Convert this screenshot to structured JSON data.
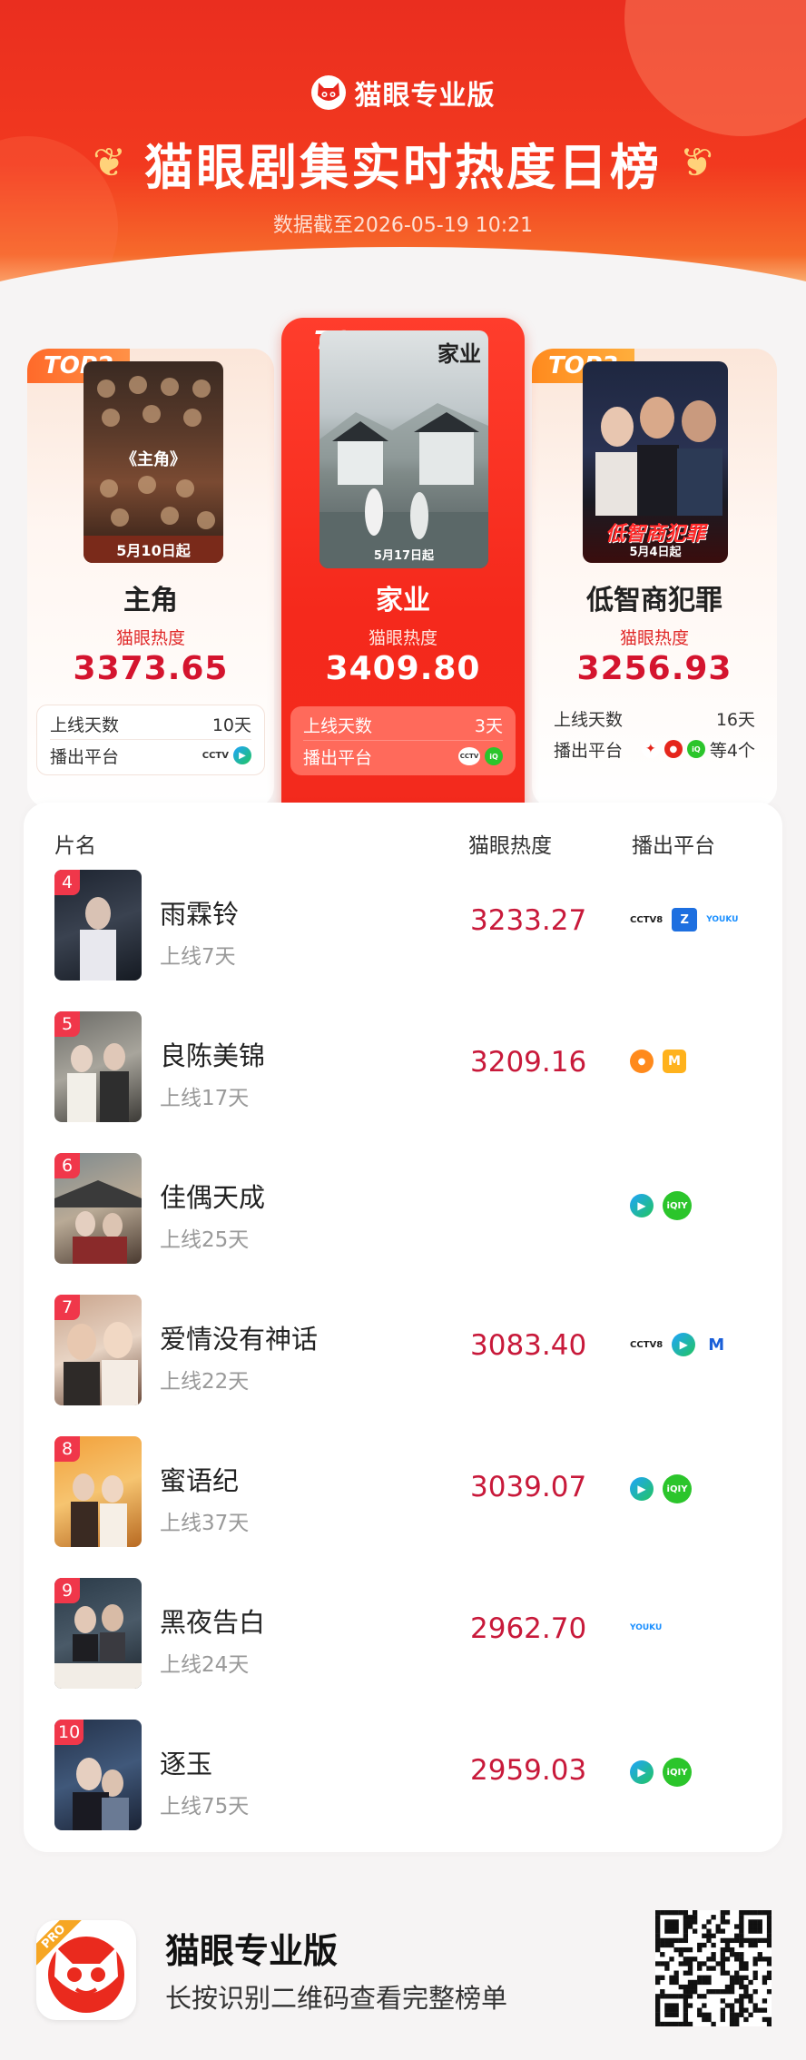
{
  "header": {
    "brand": "猫眼专业版",
    "title": "猫眼剧集实时热度日榜",
    "subtitle": "数据截至2026-05-19 10:21"
  },
  "top3": [
    {
      "badge": "TOP1",
      "name": "家业",
      "heat_label": "猫眼热度",
      "heat": "3409.80",
      "poster_title": "家业",
      "poster_date": "5月17日起",
      "days_label": "上线天数",
      "days": "3天",
      "platform_label": "播出平台",
      "platforms": [
        "cctv-icon",
        "iqiyi-icon"
      ],
      "platforms_more": ""
    },
    {
      "badge": "TOP2",
      "name": "主角",
      "heat_label": "猫眼热度",
      "heat": "3373.65",
      "poster_title": "《主角》",
      "poster_date": "5月10日起",
      "days_label": "上线天数",
      "days": "10天",
      "platform_label": "播出平台",
      "platforms": [
        "cctv-icon",
        "tencent-video-icon"
      ],
      "platforms_more": ""
    },
    {
      "badge": "TOP3",
      "name": "低智商犯罪",
      "heat_label": "猫眼热度",
      "heat": "3256.93",
      "poster_title": "低智商犯罪",
      "poster_date": "5月4日起",
      "days_label": "上线天数",
      "days": "16天",
      "platform_label": "播出平台",
      "platforms": [
        "red-icon",
        "red-dot-icon",
        "iqiyi-icon"
      ],
      "platforms_more": "等4个"
    }
  ],
  "list": {
    "columns": {
      "name": "片名",
      "heat": "猫眼热度",
      "platform": "播出平台"
    },
    "rows": [
      {
        "rank": "4",
        "name": "雨霖铃",
        "days": "上线7天",
        "heat": "3233.27",
        "platforms": [
          "cctv-icon",
          "zhejiang-tv-icon",
          "youku-icon"
        ]
      },
      {
        "rank": "5",
        "name": "良陈美锦",
        "days": "上线17天",
        "heat": "3209.16",
        "platforms": [
          "mango-icon",
          "mgtv-icon"
        ]
      },
      {
        "rank": "6",
        "name": "佳偶天成",
        "days": "上线25天",
        "heat": "",
        "platforms": [
          "tencent-video-icon",
          "iqiyi-icon"
        ]
      },
      {
        "rank": "7",
        "name": "爱情没有神话",
        "days": "上线22天",
        "heat": "3083.40",
        "platforms": [
          "cctv-icon",
          "tencent-video-icon",
          "m-icon"
        ]
      },
      {
        "rank": "8",
        "name": "蜜语纪",
        "days": "上线37天",
        "heat": "3039.07",
        "platforms": [
          "tencent-video-icon",
          "iqiyi-icon"
        ]
      },
      {
        "rank": "9",
        "name": "黑夜告白",
        "days": "上线24天",
        "heat": "2962.70",
        "platforms": [
          "youku-icon"
        ]
      },
      {
        "rank": "10",
        "name": "逐玉",
        "days": "上线75天",
        "heat": "2959.03",
        "platforms": [
          "tencent-video-icon",
          "iqiyi-icon"
        ]
      }
    ]
  },
  "footer": {
    "title": "猫眼专业版",
    "subtitle": "长按识别二维码查看完整榜单",
    "logo_badge": "PRO"
  },
  "colors": {
    "primary": "#f0301f",
    "heat": "#c8193a",
    "rank_badge": "#f0374a"
  }
}
